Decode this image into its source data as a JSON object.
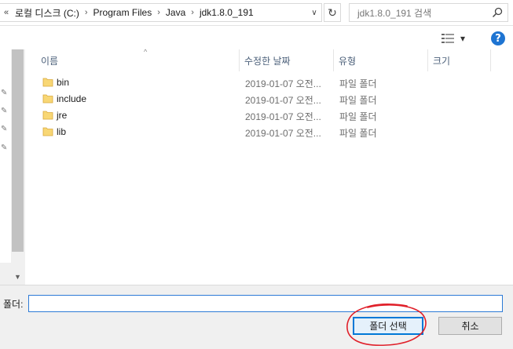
{
  "address_bar": {
    "prefix": "«",
    "crumbs": [
      "로컬 디스크 (C:)",
      "Program Files",
      "Java",
      "jdk1.8.0_191"
    ],
    "separator": "›",
    "dropdown": "∨",
    "refresh": "↻"
  },
  "search": {
    "placeholder": "jdk1.8.0_191 검색"
  },
  "toolbar": {
    "view_icon": "details-view-icon",
    "view_dropdown": "▾",
    "help": "?"
  },
  "columns": {
    "name": "이름",
    "sort_indicator": "^",
    "modified": "수정한 날짜",
    "type": "유형",
    "size": "크기"
  },
  "files": [
    {
      "name": "bin",
      "modified": "2019-01-07 오전...",
      "type": "파일 폴더"
    },
    {
      "name": "include",
      "modified": "2019-01-07 오전...",
      "type": "파일 폴더"
    },
    {
      "name": "jre",
      "modified": "2019-01-07 오전...",
      "type": "파일 폴더"
    },
    {
      "name": "lib",
      "modified": "2019-01-07 오전...",
      "type": "파일 폴더"
    }
  ],
  "footer": {
    "folder_label": "폴더:",
    "folder_value": "",
    "select_button": "폴더 선택",
    "cancel_button": "취소"
  },
  "colors": {
    "accent": "#0078d7",
    "folder": "#f8d775",
    "annotation": "#e0202a"
  }
}
